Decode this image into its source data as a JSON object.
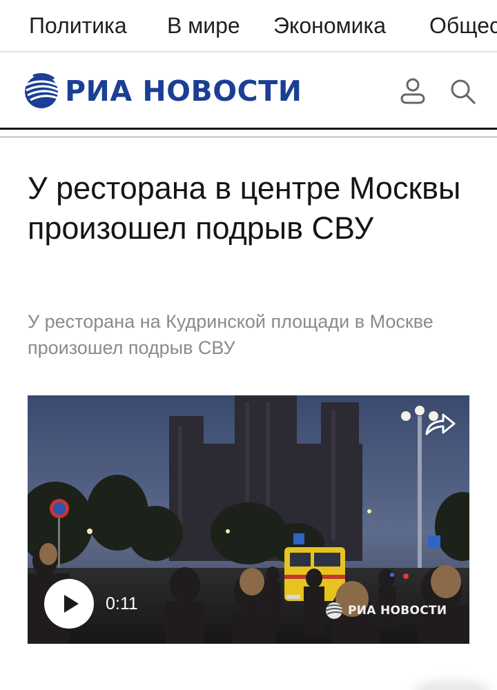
{
  "top_nav": {
    "items": [
      {
        "label": "Политика"
      },
      {
        "label": "В мире"
      },
      {
        "label": "Экономика"
      },
      {
        "label": "Общество"
      }
    ]
  },
  "header": {
    "logo_text": "РИА НОВОСТИ",
    "profile_icon": "user-icon",
    "search_icon": "search-icon"
  },
  "article": {
    "headline": "У ресторана в центре Москвы произошел подрыв СВУ",
    "lead": "У ресторана на Кудринской площади в Москве произошел подрыв СВУ"
  },
  "video": {
    "duration": "0:11",
    "watermark": "РИА НОВОСТИ",
    "share_icon": "share-arrow-icon",
    "play_icon": "play-icon"
  },
  "colors": {
    "brand": "#1b3f95",
    "headline": "#151515",
    "lead": "#8a8a8a"
  }
}
